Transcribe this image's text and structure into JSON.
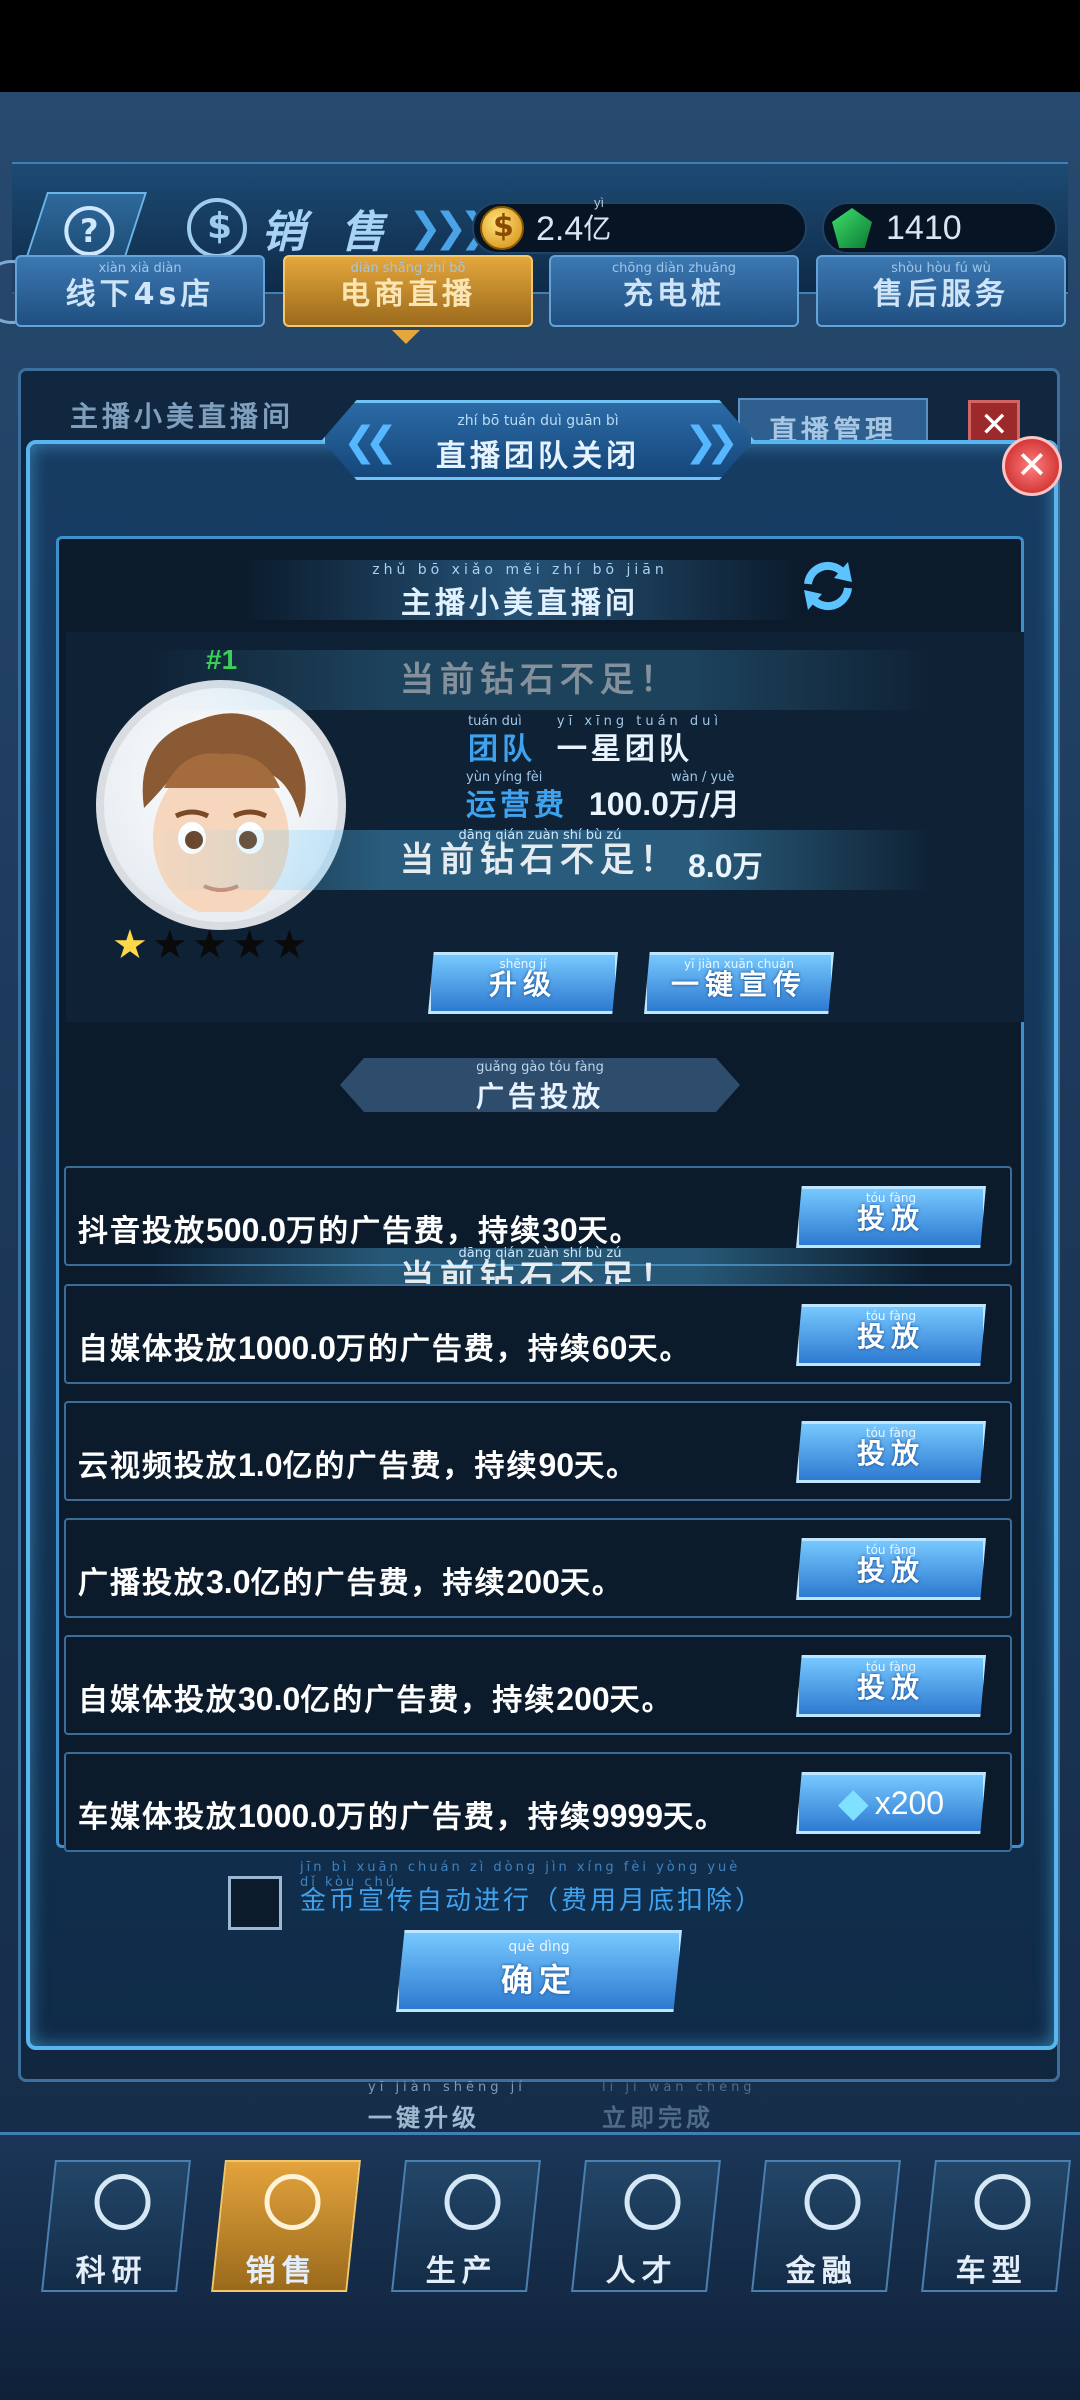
{
  "header": {
    "title": "销 售",
    "gold": "2.4",
    "gold_unit": "亿",
    "gold_unit_pinyin": "yì",
    "diamonds": "1410"
  },
  "tabs": [
    {
      "label": "线下4s店",
      "pinyin": "xiàn xià       diàn",
      "active": false
    },
    {
      "label": "电商直播",
      "pinyin": "diàn shāng zhí bō",
      "active": true
    },
    {
      "label": "充电桩",
      "pinyin": "chōng diàn zhuāng",
      "active": false
    },
    {
      "label": "售后服务",
      "pinyin": "shòu hòu  fú  wù",
      "active": false
    }
  ],
  "background": {
    "room_label": "主播小美直播间",
    "manage_button": "直播管理"
  },
  "dialog": {
    "title": "直播团队关闭",
    "title_pinyin": "zhí bō tuán duì guān bì",
    "room_name": "主播小美直播间",
    "room_name_pinyin": "zhǔ  bō  xiǎo  měi  zhí  bō  jiān",
    "rank": "#1",
    "stars_filled": 1,
    "stars_total": 5,
    "team_key": "团队",
    "team_key_pinyin": "tuán duì",
    "team_value": "一星团队",
    "team_value_pinyin": "yī  xīng tuán duì",
    "cost_key": "运营费",
    "cost_key_pinyin": "yùn yíng fèi",
    "cost_value": "100.0",
    "cost_unit": "万/月",
    "cost_unit_pinyin": "wàn  /  yuè",
    "toast_text": "当前钻石不足！",
    "toast_pinyin": "dāng qián zuàn  shí   bù   zú",
    "income_value": "8.0",
    "income_unit": "万",
    "upgrade_button": "升级",
    "upgrade_pinyin": "shēng  jí",
    "promote_button": "一键宣传",
    "promote_pinyin": "yī  jiàn xuān chuán",
    "ad_header": "广告投放",
    "ad_header_pinyin": "guǎng gào  tóu  fàng",
    "ads": [
      {
        "prefix": "抖音投放",
        "amount": "500.0",
        "unit": "万",
        "mid": "的广告费，持续",
        "days": "30",
        "suffix": "天。",
        "button": "投放",
        "button_pinyin": "tóu fàng"
      },
      {
        "prefix": "自媒体投放",
        "amount": "1000.0",
        "unit": "万",
        "mid": "的广告费，持续",
        "days": "60",
        "suffix": "天。",
        "button": "投放",
        "button_pinyin": "tóu fàng"
      },
      {
        "prefix": "云视频投放",
        "amount": "1.0",
        "unit": "亿",
        "mid": "的广告费，持续",
        "days": "90",
        "suffix": "天。",
        "button": "投放",
        "button_pinyin": "tóu fàng"
      },
      {
        "prefix": "广播投放",
        "amount": "3.0",
        "unit": "亿",
        "mid": "的广告费，持续",
        "days": "200",
        "suffix": "天。",
        "button": "投放",
        "button_pinyin": "tóu fàng"
      },
      {
        "prefix": "自媒体投放",
        "amount": "30.0",
        "unit": "亿",
        "mid": "的广告费，持续",
        "days": "200",
        "suffix": "天。",
        "button": "投放",
        "button_pinyin": "tóu fàng"
      },
      {
        "prefix": "车媒体投放",
        "amount": "1000.0",
        "unit": "万",
        "mid": "的广告费，持续",
        "days": "9999",
        "suffix": "天。",
        "button": "x200",
        "button_pinyin": ""
      }
    ],
    "auto_text": "金币宣传自动进行（费用月底扣除）",
    "auto_pinyin": "jīn  bì  xuān chuán  zì  dòng  jìn  xíng        fèi yòng yuè  dǐ  kòu  chú",
    "confirm_button": "确定",
    "confirm_pinyin": "què  dìng"
  },
  "under_actions": {
    "upgrade_all": "一键升级",
    "upgrade_all_pinyin": "yī  jiàn shēng  jí",
    "finish_now": "立即完成",
    "finish_now_pinyin": "lì   jí  wán chéng"
  },
  "nav": [
    {
      "label": "科研",
      "icon": "gear-atom-icon",
      "active": false
    },
    {
      "label": "销售",
      "icon": "money-hand-icon",
      "active": true
    },
    {
      "label": "生产",
      "icon": "wrench-icon",
      "active": false
    },
    {
      "label": "人才",
      "icon": "search-person-icon",
      "active": false
    },
    {
      "label": "金融",
      "icon": "chart-icon",
      "active": false
    },
    {
      "label": "车型",
      "icon": "garage-car-icon",
      "active": false
    }
  ],
  "colors": {
    "accent": "#3ea2ee",
    "active_tab": "#e5a73c",
    "rank_green": "#36d04a",
    "star": "#ffd84a"
  }
}
